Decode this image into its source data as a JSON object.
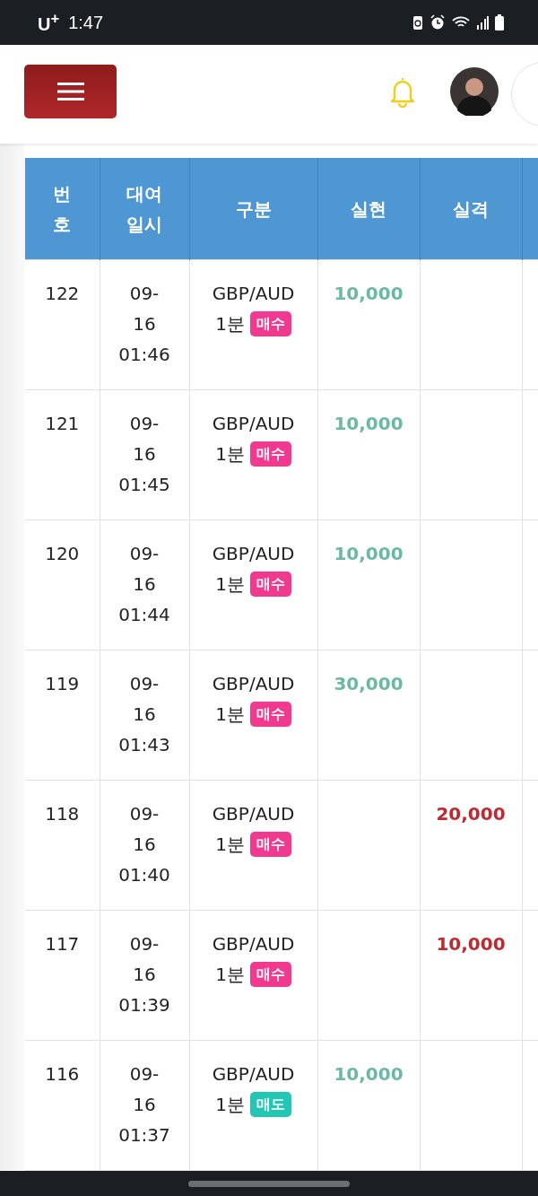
{
  "status_bar": {
    "carrier": "U$^{+}$",
    "time": "1:47"
  },
  "table": {
    "columns": [
      "번\n호",
      "대여\n일시",
      "구분",
      "실현",
      "실격"
    ],
    "rows": [
      {
        "no": "122",
        "date": "09-\n16\n01:46",
        "pair": "GBP/AUD",
        "period": "1분",
        "side": {
          "label": "매수",
          "kind": "buy"
        },
        "realized": "10,000"
      },
      {
        "no": "121",
        "date": "09-\n16\n01:45",
        "pair": "GBP/AUD",
        "period": "1분",
        "side": {
          "label": "매수",
          "kind": "buy"
        },
        "realized": "10,000"
      },
      {
        "no": "120",
        "date": "09-\n16\n01:44",
        "pair": "GBP/AUD",
        "period": "1분",
        "side": {
          "label": "매수",
          "kind": "buy"
        },
        "realized": "10,000"
      },
      {
        "no": "119",
        "date": "09-\n16\n01:43",
        "pair": "GBP/AUD",
        "period": "1분",
        "side": {
          "label": "매수",
          "kind": "buy"
        },
        "realized": "30,000"
      },
      {
        "no": "118",
        "date": "09-\n16\n01:40",
        "pair": "GBP/AUD",
        "period": "1분",
        "side": {
          "label": "매수",
          "kind": "buy"
        },
        "lost": "20,000"
      },
      {
        "no": "117",
        "date": "09-\n16\n01:39",
        "pair": "GBP/AUD",
        "period": "1분",
        "side": {
          "label": "매수",
          "kind": "buy"
        },
        "lost": "10,000"
      },
      {
        "no": "116",
        "date": "09-\n16\n01:37",
        "pair": "GBP/AUD",
        "period": "1분",
        "side": {
          "label": "매도",
          "kind": "sell"
        },
        "realized": "10,000"
      }
    ]
  }
}
